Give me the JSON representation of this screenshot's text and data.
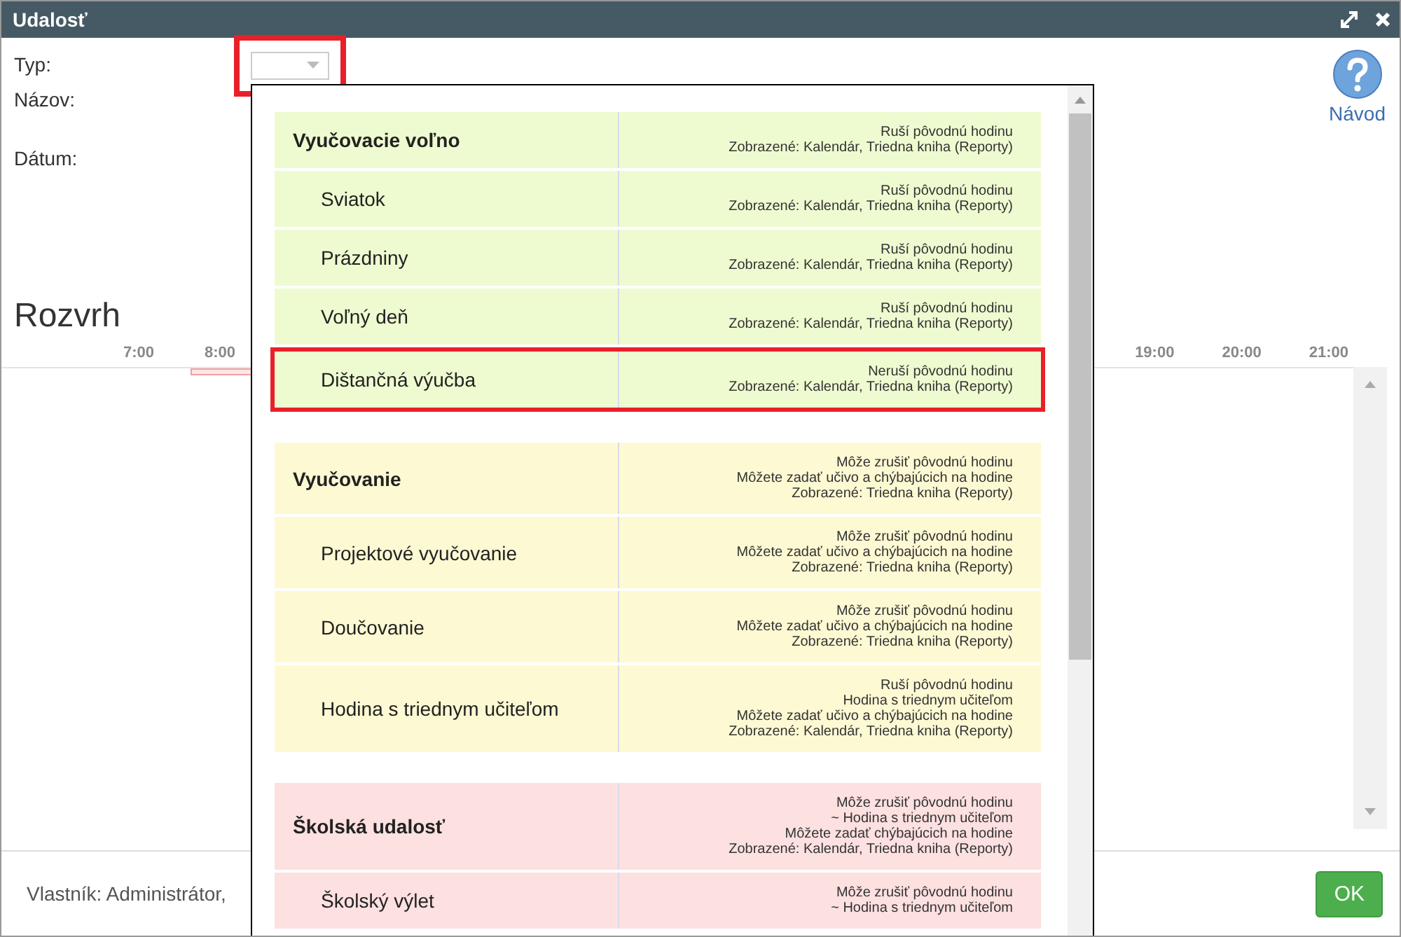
{
  "window": {
    "title": "Udalosť"
  },
  "form": {
    "fields": [
      {
        "label": "Typ:"
      },
      {
        "label": "Názov:"
      },
      {
        "label": "Dátum:"
      }
    ],
    "type_select": {
      "highlighted": true
    }
  },
  "help": {
    "label": "Návod"
  },
  "schedule": {
    "title": "Rozvrh",
    "times_left": [
      "7:00",
      "8:00"
    ],
    "times_right": [
      "19:00",
      "20:00",
      "21:00"
    ]
  },
  "footer": {
    "owner": "Vlastník: Administrátor,",
    "ok": "OK"
  },
  "dropdown": {
    "groups": [
      {
        "color": "#eefbd0",
        "header": {
          "label": "Vyučovacie voľno",
          "note": [
            "Ruší pôvodnú hodinu",
            "Zobrazené: Kalendár, Triedna kniha (Reporty)"
          ]
        },
        "items": [
          {
            "label": "Sviatok",
            "note": [
              "Ruší pôvodnú hodinu",
              "Zobrazené: Kalendár, Triedna kniha (Reporty)"
            ],
            "highlighted": false
          },
          {
            "label": "Prázdniny",
            "note": [
              "Ruší pôvodnú hodinu",
              "Zobrazené: Kalendár, Triedna kniha (Reporty)"
            ],
            "highlighted": false
          },
          {
            "label": "Voľný deň",
            "note": [
              "Ruší pôvodnú hodinu",
              "Zobrazené: Kalendár, Triedna kniha (Reporty)"
            ],
            "highlighted": false
          },
          {
            "label": "Dištančná výučba",
            "note": [
              "Neruší pôvodnú hodinu",
              "Zobrazené: Kalendár, Triedna kniha (Reporty)"
            ],
            "highlighted": true
          }
        ]
      },
      {
        "color": "#fdf9d3",
        "header": {
          "label": "Vyučovanie",
          "note": [
            "Môže zrušiť pôvodnú hodinu",
            "Môžete zadať učivo a chýbajúcich na hodine",
            "Zobrazené: Triedna kniha (Reporty)"
          ]
        },
        "items": [
          {
            "label": "Projektové vyučovanie",
            "note": [
              "Môže zrušiť pôvodnú hodinu",
              "Môžete zadať učivo a chýbajúcich na hodine",
              "Zobrazené: Triedna kniha (Reporty)"
            ],
            "highlighted": false
          },
          {
            "label": "Doučovanie",
            "note": [
              "Môže zrušiť pôvodnú hodinu",
              "Môžete zadať učivo a chýbajúcich na hodine",
              "Zobrazené: Triedna kniha (Reporty)"
            ],
            "highlighted": false
          },
          {
            "label": "Hodina s triednym učiteľom",
            "note": [
              "Ruší pôvodnú hodinu",
              "Hodina s triednym učiteľom",
              "Môžete zadať učivo a chýbajúcich na hodine",
              "Zobrazené: Kalendár, Triedna kniha (Reporty)"
            ],
            "highlighted": false
          }
        ]
      },
      {
        "color": "#fde0e0",
        "header": {
          "label": "Školská udalosť",
          "note": [
            "Môže zrušiť pôvodnú hodinu",
            "~ Hodina s triednym učiteľom",
            "Môžete zadať chýbajúcich na hodine",
            "Zobrazené: Kalendár, Triedna kniha (Reporty)"
          ]
        },
        "items": [
          {
            "label": "Školský výlet",
            "note": [
              "Môže zrušiť pôvodnú hodinu",
              "~ Hodina s triednym učiteľom"
            ],
            "highlighted": false
          }
        ]
      }
    ]
  }
}
